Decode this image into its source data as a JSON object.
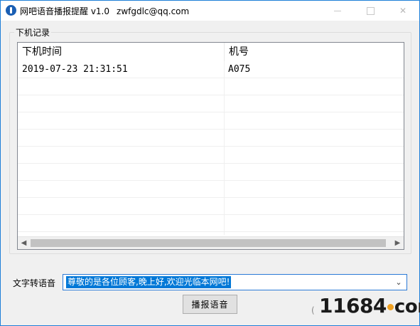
{
  "window": {
    "title": "网吧语音播报提醒 v1.0",
    "contact": "zwfgdlc@qq.com"
  },
  "group": {
    "label": "下机记录"
  },
  "list": {
    "columns": [
      "下机时间",
      "机号"
    ],
    "rows": [
      {
        "time": "2019-07-23 21:31:51",
        "machine": "A075"
      }
    ]
  },
  "tts": {
    "label": "文字转语音",
    "value": "尊敬的是各位顾客,晚上好,欢迎光临本网吧!"
  },
  "play_button_label": "播报语音",
  "corner_glyph": "(",
  "watermark": {
    "number": "11684",
    "tld": "com"
  },
  "colors": {
    "selection": "#0078d7",
    "window_border": "#1e7fd8",
    "watermark_dot": "#f0a020"
  },
  "icons": {
    "app": "app-icon",
    "minimize": "minimize-icon",
    "maximize": "maximize-icon",
    "close": "close-icon",
    "dropdown": "chevron-down-icon",
    "scroll_left": "scroll-left-icon",
    "scroll_right": "scroll-right-icon"
  }
}
